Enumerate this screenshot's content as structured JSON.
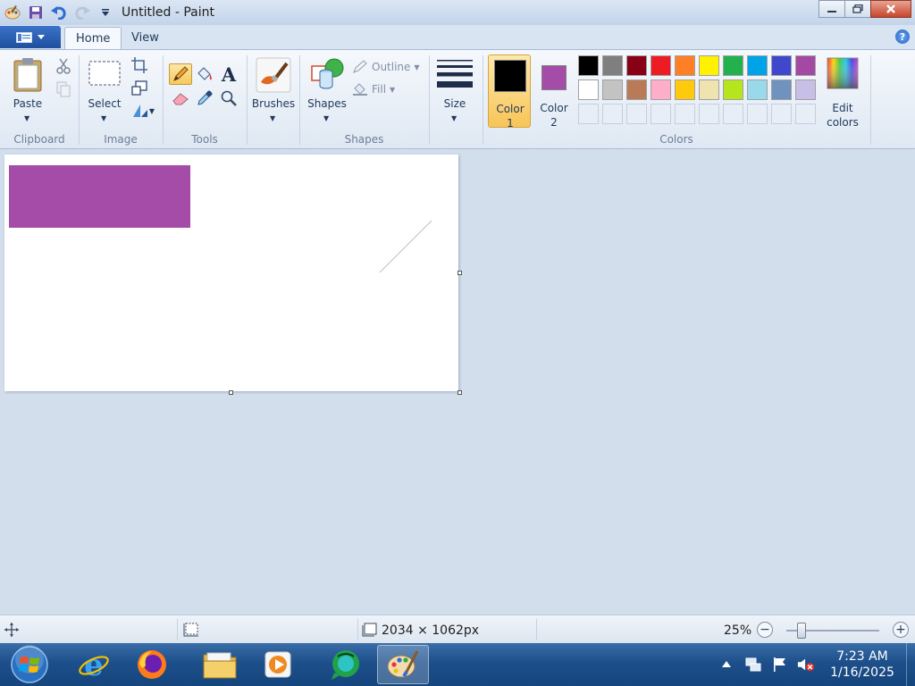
{
  "window": {
    "title": "Untitled - Paint"
  },
  "tabs": [
    {
      "label": "Home"
    },
    {
      "label": "View"
    }
  ],
  "help": {
    "glyph": "?"
  },
  "clipboard": {
    "paste_label": "Paste",
    "group_label": "Clipboard"
  },
  "image": {
    "select_label": "Select",
    "group_label": "Image"
  },
  "tools": {
    "group_label": "Tools",
    "selected_tool": "pencil"
  },
  "brushes": {
    "label": "Brushes"
  },
  "shapes": {
    "label": "Shapes",
    "outline_label": "Outline",
    "fill_label": "Fill",
    "group_label": "Shapes"
  },
  "size": {
    "label": "Size"
  },
  "colors": {
    "color1_label_line1": "Color",
    "color1_label_line2": "1",
    "color2_label_line1": "Color",
    "color2_label_line2": "2",
    "color1": "#000000",
    "color2": "#a54ba8",
    "edit_line1": "Edit",
    "edit_line2": "colors",
    "group_label": "Colors",
    "palette_row1": [
      "#000000",
      "#7f7f7f",
      "#880015",
      "#ed1c24",
      "#ff7f27",
      "#fff200",
      "#22b14c",
      "#00a2e8",
      "#3f48cc",
      "#a349a4"
    ],
    "palette_row2": [
      "#ffffff",
      "#c3c3c3",
      "#b97a57",
      "#ffaec9",
      "#ffc90e",
      "#efe4b0",
      "#b5e61d",
      "#99d9ea",
      "#7092be",
      "#c8bfe7"
    ],
    "palette_row3_count": 10
  },
  "canvas": {
    "text": "",
    "rect_color": "#a54ba8"
  },
  "status": {
    "dimensions": "2034 × 1062px",
    "zoom": "25%",
    "zoom_level_percent": 25
  },
  "taskbar": {
    "time": "7:23 AM",
    "date": "1/16/2025"
  }
}
